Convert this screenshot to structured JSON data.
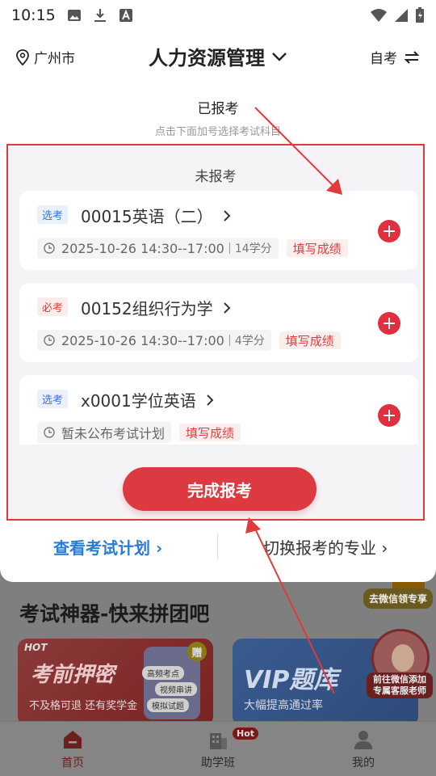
{
  "status_bar": {
    "time": "10:15"
  },
  "header": {
    "location": "广州市",
    "major": "人力资源管理",
    "mode": "自考"
  },
  "modal": {
    "title": "已报考",
    "hint": "点击下面加号选择考试科目",
    "section_title": "未报考",
    "courses": [
      {
        "badge": "选考",
        "badge_type": "elect",
        "name": "00015英语（二）",
        "schedule": "2025-10-26 14:30--17:00",
        "credits": "14学分",
        "action": "填写成绩"
      },
      {
        "badge": "必考",
        "badge_type": "required",
        "name": "00152组织行为学",
        "schedule": "2025-10-26 14:30--17:00",
        "credits": "4学分",
        "action": "填写成绩"
      },
      {
        "badge": "选考",
        "badge_type": "elect",
        "name": "x0001学位英语",
        "schedule": "暂未公布考试计划",
        "credits": "",
        "action": "填写成绩"
      }
    ],
    "done_button": "完成报考",
    "link_plan": "查看考试计划 ›",
    "link_switch": "切换报考的专业 ›"
  },
  "background": {
    "section_title": "考试神器-快来拼团吧",
    "banner1": {
      "hot": "HOT",
      "title": "考前押密",
      "subtitle": "不及格可退 还有奖学金",
      "tags": [
        "高频考点",
        "视频串讲",
        "模拟试题"
      ],
      "stamp": "赠"
    },
    "banner2": {
      "title": "VIP题库",
      "subtitle": "大幅提高通过率"
    },
    "wechat_badge": "去微信领专享",
    "advisor_label": "前往微信添加 专属客服老师"
  },
  "tabbar": [
    {
      "label": "首页",
      "active": true,
      "icon": "home-icon"
    },
    {
      "label": "助学班",
      "active": false,
      "icon": "building-icon",
      "badge": "Hot"
    },
    {
      "label": "我的",
      "active": false,
      "icon": "user-icon"
    }
  ],
  "colors": {
    "accent": "#dc3a40",
    "link": "#2a7ad6",
    "annotation": "#e03a3a"
  }
}
